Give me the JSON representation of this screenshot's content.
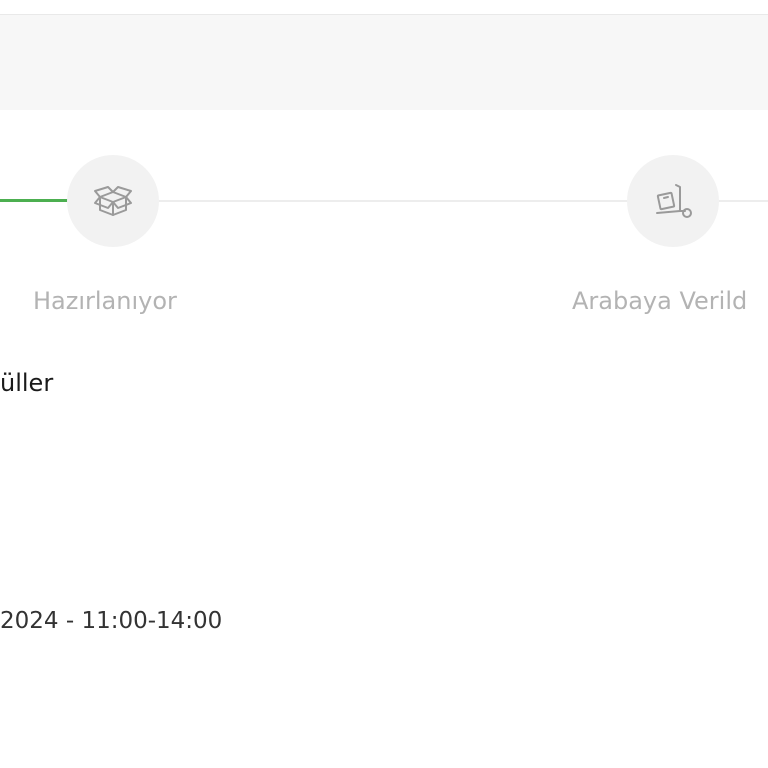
{
  "header": {
    "band": ""
  },
  "order_status": {
    "progress_color": "#4caf50",
    "steps": [
      {
        "label": "Hazırlanıyor",
        "icon": "open-box-icon",
        "completed": false
      },
      {
        "label": "Arabaya Verild",
        "icon": "hand-truck-icon",
        "completed": false
      }
    ]
  },
  "products": {
    "heading": "üller"
  },
  "delivery": {
    "time_text": "2024 - 11:00-14:00"
  }
}
